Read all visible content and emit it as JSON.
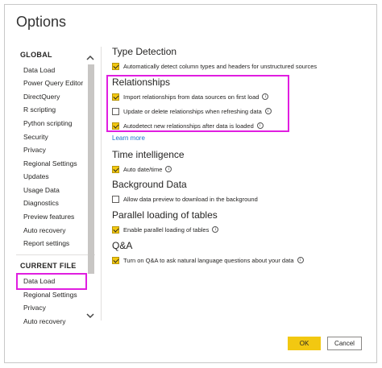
{
  "dialog": {
    "title": "Options"
  },
  "sidebar": {
    "global_header": "GLOBAL",
    "global_items": [
      {
        "label": "Data Load"
      },
      {
        "label": "Power Query Editor"
      },
      {
        "label": "DirectQuery"
      },
      {
        "label": "R scripting"
      },
      {
        "label": "Python scripting"
      },
      {
        "label": "Security"
      },
      {
        "label": "Privacy"
      },
      {
        "label": "Regional Settings"
      },
      {
        "label": "Updates"
      },
      {
        "label": "Usage Data"
      },
      {
        "label": "Diagnostics"
      },
      {
        "label": "Preview features"
      },
      {
        "label": "Auto recovery"
      },
      {
        "label": "Report settings"
      }
    ],
    "current_file_header": "CURRENT FILE",
    "current_file_items": [
      {
        "label": "Data Load",
        "selected": true
      },
      {
        "label": "Regional Settings"
      },
      {
        "label": "Privacy"
      },
      {
        "label": "Auto recovery"
      }
    ],
    "scroll_up_icon": "chevron-up-icon",
    "scroll_down_icon": "chevron-down-icon"
  },
  "content": {
    "type_detection": {
      "heading": "Type Detection",
      "options": [
        {
          "label": "Automatically detect column types and headers for unstructured sources",
          "checked": true
        }
      ]
    },
    "relationships": {
      "heading": "Relationships",
      "options": [
        {
          "label": "Import relationships from data sources on first load",
          "checked": true
        },
        {
          "label": "Update or delete relationships when refreshing data",
          "checked": false
        },
        {
          "label": "Autodetect new relationships after data is loaded",
          "checked": true
        }
      ],
      "learn_more": "Learn more"
    },
    "time_intelligence": {
      "heading": "Time intelligence",
      "options": [
        {
          "label": "Auto date/time",
          "checked": true
        }
      ]
    },
    "background_data": {
      "heading": "Background Data",
      "options": [
        {
          "label": "Allow data preview to download in the background",
          "checked": false
        }
      ]
    },
    "parallel_loading": {
      "heading": "Parallel loading of tables",
      "options": [
        {
          "label": "Enable parallel loading of tables",
          "checked": true
        }
      ]
    },
    "qa": {
      "heading": "Q&A",
      "options": [
        {
          "label": "Turn on Q&A to ask natural language questions about your data",
          "checked": true
        }
      ]
    }
  },
  "buttons": {
    "ok": "OK",
    "cancel": "Cancel"
  },
  "colors": {
    "accent": "#f2c811",
    "highlight": "#e01ee0",
    "link": "#1a73c8"
  },
  "info_icon_glyph": "i"
}
